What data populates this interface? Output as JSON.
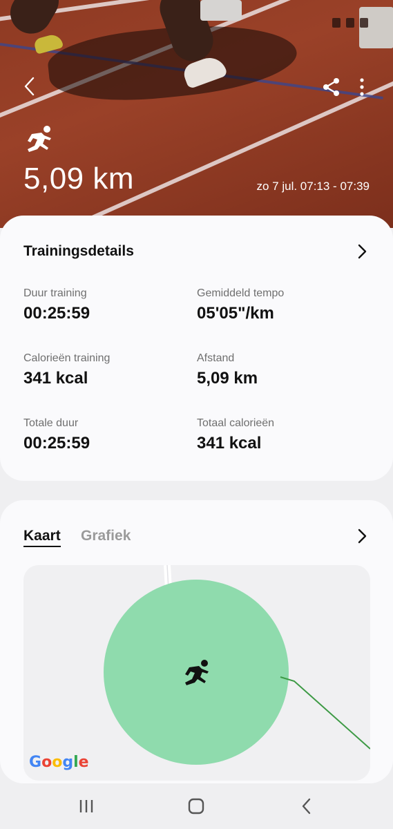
{
  "header": {
    "distance": "5,09 km",
    "date_range": "zo 7 jul. 07:13 - 07:39"
  },
  "details": {
    "title": "Trainingsdetails",
    "stats": [
      {
        "label": "Duur training",
        "value": "00:25:59"
      },
      {
        "label": "Gemiddeld tempo",
        "value": "05'05\"/km"
      },
      {
        "label": "Calorieën training",
        "value": "341 kcal"
      },
      {
        "label": "Afstand",
        "value": "5,09 km"
      },
      {
        "label": "Totale duur",
        "value": "00:25:59"
      },
      {
        "label": "Totaal calorieën",
        "value": "341 kcal"
      }
    ]
  },
  "map_card": {
    "tabs": [
      {
        "label": "Kaart",
        "active": true
      },
      {
        "label": "Grafiek",
        "active": false
      }
    ],
    "logo": "Google"
  },
  "icons": {
    "back": "back-arrow-icon",
    "share": "share-icon",
    "more": "more-vertical-icon",
    "run": "running-person-icon",
    "chevron": "chevron-right-icon"
  },
  "colors": {
    "map_circle": "#8fdbad",
    "route_line": "#3d9a45"
  }
}
